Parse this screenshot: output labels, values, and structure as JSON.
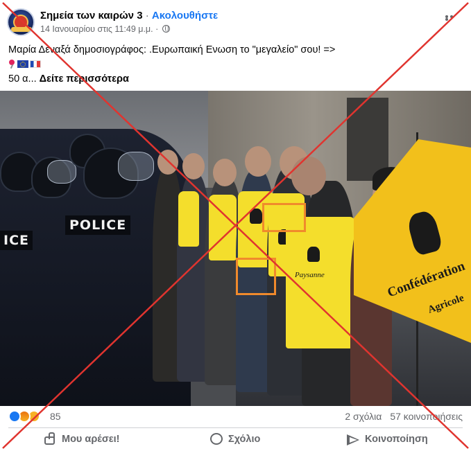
{
  "post": {
    "page_name": "Σημεία των καιρών 3",
    "separator": " · ",
    "follow_label": "Ακολουθήστε",
    "timestamp": "14 Ιανουαρίου στις 11:49 μ.μ.",
    "meta_separator": " · ",
    "text_line1": "Μαρία Δεναξά δημοσιογράφος: .Ευρωπαική Ενωση το \"μεγαλείο\" σου! =>",
    "text_line3_prefix": "50 α...",
    "see_more_label": "Δείτε περισσότερα"
  },
  "photo": {
    "police_label_1": "POLICE",
    "police_label_2": "ICE",
    "banner_text_1": "Confédération",
    "banner_text_2": "Agricole",
    "vest_text": "Paysanne"
  },
  "engagement": {
    "reaction_count": "85",
    "comments": "2 σχόλια",
    "shares": "57 κοινοποιήσεις"
  },
  "actions": {
    "like_label": "Μου αρέσει!",
    "comment_label": "Σχόλιο",
    "share_label": "Κοινοποίηση"
  },
  "colors": {
    "accent": "#1877f2",
    "cross": "#e0342f",
    "highlight": "#f08a2c",
    "vest": "#f4de2c"
  },
  "icons": [
    "globe-icon",
    "more-options-icon",
    "pin-icon",
    "eu-flag-icon",
    "france-flag-icon",
    "like-reaction-icon",
    "angry-reaction-icon",
    "sad-reaction-icon",
    "like-icon",
    "comment-icon",
    "share-icon"
  ]
}
